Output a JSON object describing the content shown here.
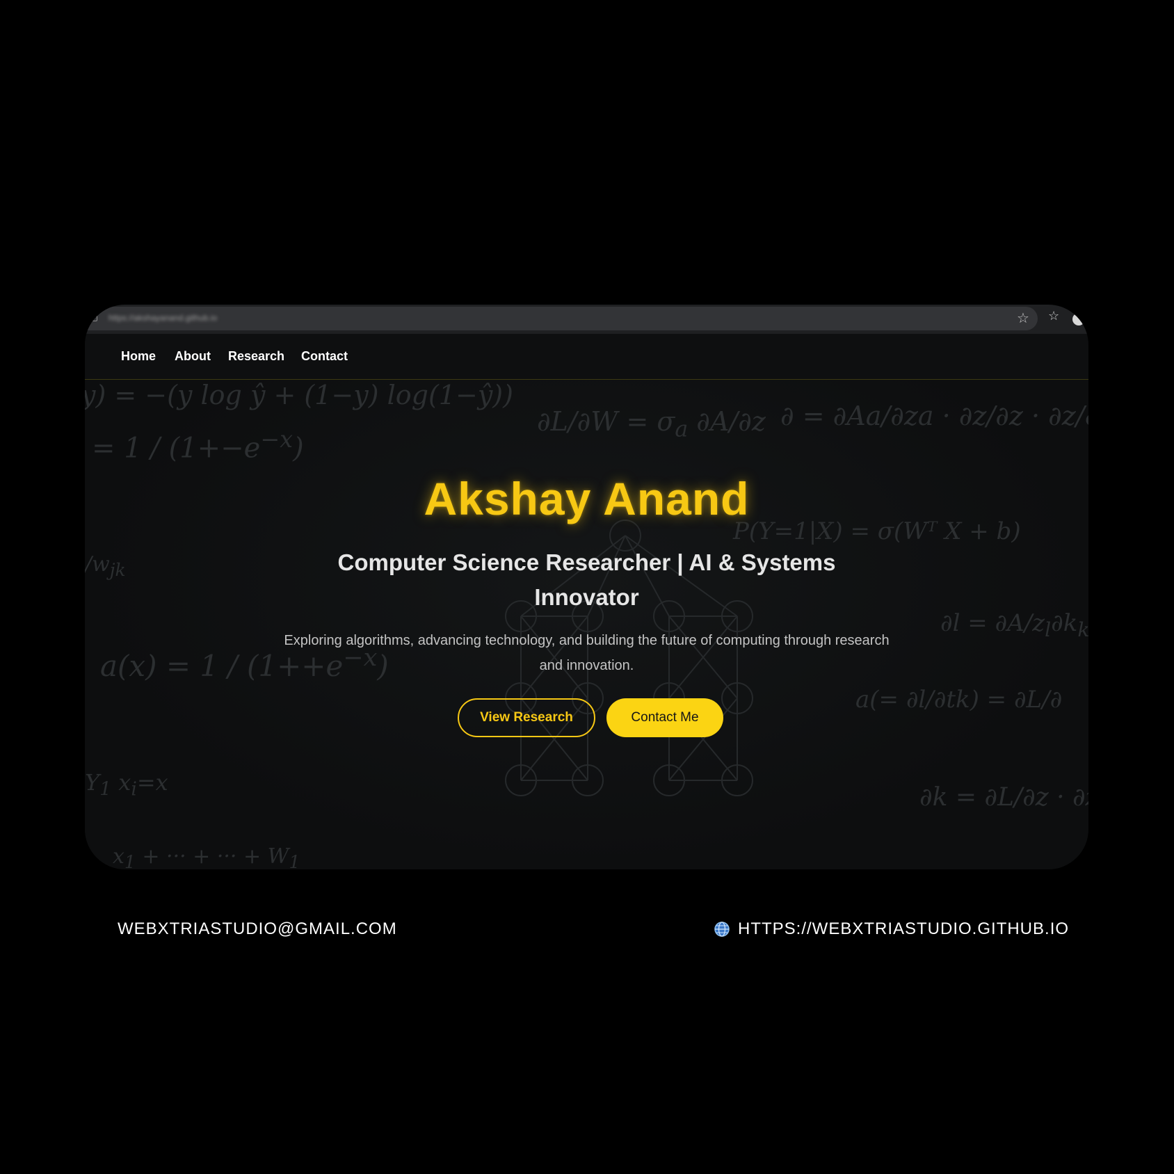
{
  "browser": {
    "url_text": "https://akshayanand.github.io",
    "icons": [
      "lock-icon",
      "star-icon",
      "favorites-icon",
      "profile-icon"
    ]
  },
  "nav": {
    "items": [
      {
        "label": "Home"
      },
      {
        "label": "About"
      },
      {
        "label": "Research"
      },
      {
        "label": "Contact"
      }
    ]
  },
  "hero": {
    "title": "Akshay Anand",
    "subtitle": "Computer Science Researcher | AI & Systems Innovator",
    "description": "Exploring algorithms, advancing technology, and building the future of computing through research and innovation.",
    "primary_button": "View Research",
    "secondary_button": "Contact Me"
  },
  "footer": {
    "email": "WEBXTRIASTUDIO@GMAIL.COM",
    "website": "HTTPS://WEBXTRIASTUDIO.GITHUB.IO"
  },
  "colors": {
    "background": "#000000",
    "accent": "#f7c814",
    "button_fill": "#fbd413",
    "hero_bg": "#0d0e0f"
  }
}
